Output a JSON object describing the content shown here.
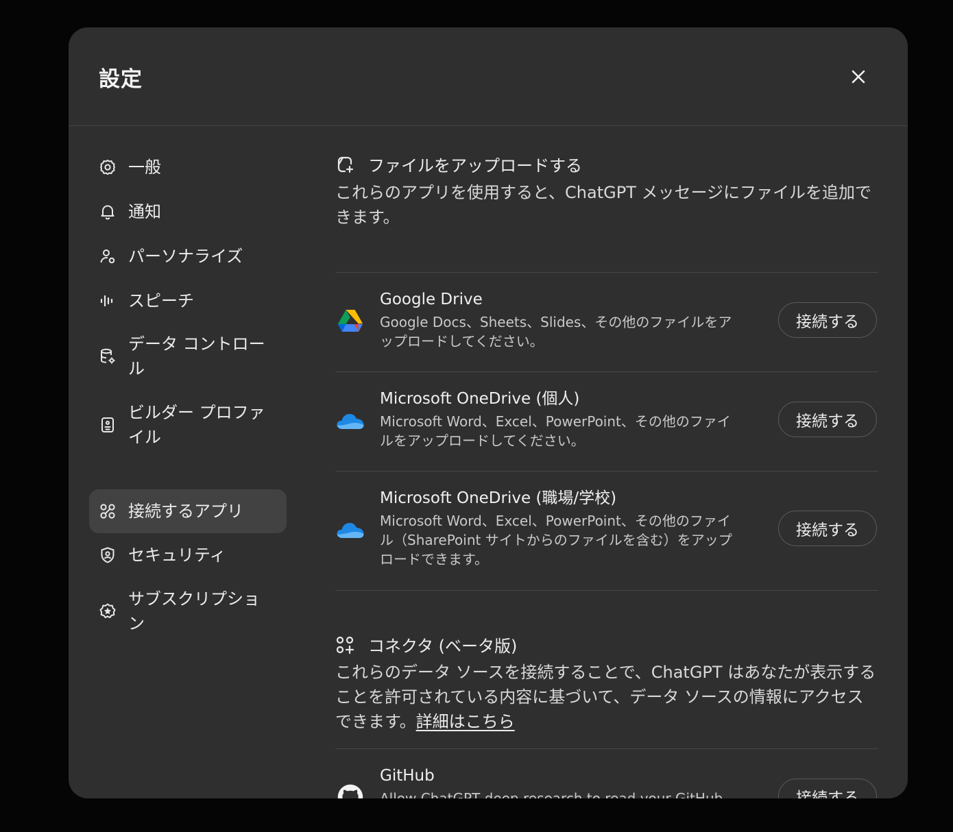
{
  "modal": {
    "title": "設定",
    "close_icon": "close-icon"
  },
  "sidebar": {
    "items": [
      {
        "label": "一般",
        "icon": "gear-icon"
      },
      {
        "label": "通知",
        "icon": "bell-icon"
      },
      {
        "label": "パーソナライズ",
        "icon": "personalize-icon"
      },
      {
        "label": "スピーチ",
        "icon": "waveform-icon"
      },
      {
        "label": "データ コントロール",
        "icon": "database-gear-icon"
      },
      {
        "label": "ビルダー プロファイル",
        "icon": "id-card-icon"
      },
      {
        "label": "接続するアプリ",
        "icon": "apps-grid-icon",
        "active": true
      },
      {
        "label": "セキュリティ",
        "icon": "shield-icon"
      },
      {
        "label": "サブスクリプション",
        "icon": "subscription-badge-icon"
      }
    ]
  },
  "upload_section": {
    "title": "ファイルをアップロードする",
    "icon": "file-upload-icon",
    "description": "これらのアプリを使用すると、ChatGPT メッセージにファイルを追加できます。",
    "apps": [
      {
        "name": "Google Drive",
        "icon": "google-drive-icon",
        "description": "Google Docs、Sheets、Slides、その他のファイルをアップロードしてください。",
        "button": "接続する"
      },
      {
        "name": "Microsoft OneDrive (個人)",
        "icon": "onedrive-icon",
        "description": "Microsoft Word、Excel、PowerPoint、その他のファイルをアップロードしてください。",
        "button": "接続する"
      },
      {
        "name": "Microsoft OneDrive (職場/学校)",
        "icon": "onedrive-icon",
        "description": "Microsoft Word、Excel、PowerPoint、その他のファイル（SharePoint サイトからのファイルを含む）をアップロードできます。",
        "button": "接続する"
      }
    ]
  },
  "connector_section": {
    "title": "コネクタ (ベータ版)",
    "icon": "connector-grid-icon",
    "description": "これらのデータ ソースを接続することで、ChatGPT はあなたが表示することを許可されている内容に基づいて、データ ソースの情報にアクセスできます。",
    "link": "詳細はこちら",
    "apps": [
      {
        "name": "GitHub",
        "icon": "github-icon",
        "description": "Allow ChatGPT deep research to read your GitHub repositories.",
        "button": "接続する"
      }
    ]
  }
}
